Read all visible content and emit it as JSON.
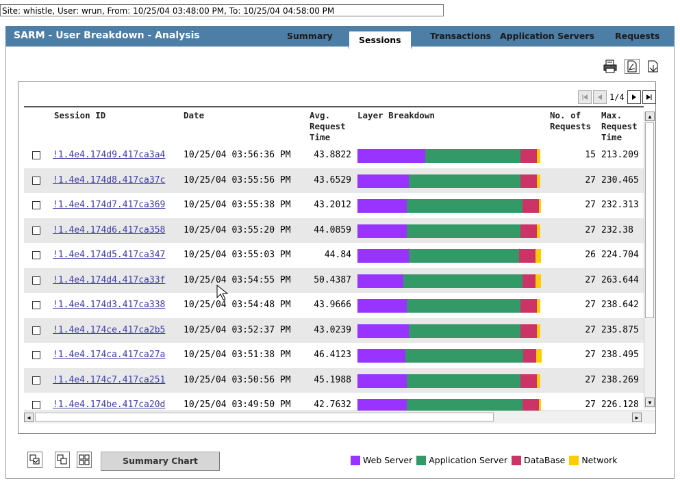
{
  "site_bar": "Site: whistle, User: wrun, From: 10/25/04 03:48:00 PM, To: 10/25/04 04:58:00 PM",
  "app_title": "SARM - User Breakdown - Analysis",
  "tabs": [
    {
      "label": "Summary",
      "active": false
    },
    {
      "label": "Sessions",
      "active": true
    },
    {
      "label": "Transactions",
      "active": false
    },
    {
      "label": "Application Servers",
      "active": false
    },
    {
      "label": "Requests",
      "active": false
    }
  ],
  "toolbar_icons": [
    "print-icon",
    "export-pdf-icon",
    "export-icon"
  ],
  "pager": {
    "page": "1/4"
  },
  "columns": {
    "session_id": "Session ID",
    "date": "Date",
    "avg_request_time": [
      "Avg.",
      "Request",
      "Time"
    ],
    "layer_breakdown": "Layer Breakdown",
    "no_of_requests": [
      "No. of",
      "Requests"
    ],
    "max_request_time": [
      "Max.",
      "Request",
      "Time"
    ]
  },
  "colors": {
    "web_server": "#9933ff",
    "application_server": "#339966",
    "database": "#cc3366",
    "network": "#ffcc00"
  },
  "rows": [
    {
      "id": "!1.4e4.174d9.417ca3a4",
      "date": "10/25/04 03:56:36 PM",
      "avg": "43.8822",
      "bd": [
        0.37,
        0.52,
        0.09,
        0.02
      ],
      "n": "15",
      "max": "213.209"
    },
    {
      "id": "!1.4e4.174d8.417ca37c",
      "date": "10/25/04 03:55:56 PM",
      "avg": "43.6529",
      "bd": [
        0.28,
        0.61,
        0.09,
        0.02
      ],
      "n": "27",
      "max": "230.465"
    },
    {
      "id": "!1.4e4.174d7.417ca369",
      "date": "10/25/04 03:55:38 PM",
      "avg": "43.2012",
      "bd": [
        0.27,
        0.63,
        0.09,
        0.01
      ],
      "n": "27",
      "max": "232.313"
    },
    {
      "id": "!1.4e4.174d6.417ca358",
      "date": "10/25/04 03:55:20 PM",
      "avg": "44.0859",
      "bd": [
        0.27,
        0.62,
        0.09,
        0.02
      ],
      "n": "27",
      "max": "232.38"
    },
    {
      "id": "!1.4e4.174d5.417ca347",
      "date": "10/25/04 03:55:03 PM",
      "avg": "44.84",
      "bd": [
        0.28,
        0.6,
        0.09,
        0.03
      ],
      "n": "26",
      "max": "224.704"
    },
    {
      "id": "!1.4e4.174d4.417ca33f",
      "date": "10/25/04 03:54:55 PM",
      "avg": "50.4387",
      "bd": [
        0.25,
        0.65,
        0.07,
        0.03
      ],
      "n": "27",
      "max": "263.644"
    },
    {
      "id": "!1.4e4.174d3.417ca338",
      "date": "10/25/04 03:54:48 PM",
      "avg": "43.9666",
      "bd": [
        0.27,
        0.62,
        0.09,
        0.02
      ],
      "n": "27",
      "max": "238.642"
    },
    {
      "id": "!1.4e4.174ce.417ca2b5",
      "date": "10/25/04 03:52:37 PM",
      "avg": "43.0239",
      "bd": [
        0.28,
        0.61,
        0.09,
        0.02
      ],
      "n": "27",
      "max": "235.875"
    },
    {
      "id": "!1.4e4.174ca.417ca27a",
      "date": "10/25/04 03:51:38 PM",
      "avg": "46.4123",
      "bd": [
        0.26,
        0.64,
        0.07,
        0.03
      ],
      "n": "27",
      "max": "238.495"
    },
    {
      "id": "!1.4e4.174c7.417ca251",
      "date": "10/25/04 03:50:56 PM",
      "avg": "45.1988",
      "bd": [
        0.27,
        0.62,
        0.09,
        0.02
      ],
      "n": "27",
      "max": "238.269"
    },
    {
      "id": "!1.4e4.174be.417ca20d",
      "date": "10/25/04 03:49:50 PM",
      "avg": "42.7632",
      "bd": [
        0.27,
        0.63,
        0.09,
        0.01
      ],
      "n": "27",
      "max": "226.128"
    }
  ],
  "summary_chart_label": "Summary Chart",
  "legend": [
    {
      "label": "Web Server",
      "color": "#9933ff"
    },
    {
      "label": "Application Server",
      "color": "#339966"
    },
    {
      "label": "DataBase",
      "color": "#cc3366"
    },
    {
      "label": "Network",
      "color": "#ffcc00"
    }
  ]
}
